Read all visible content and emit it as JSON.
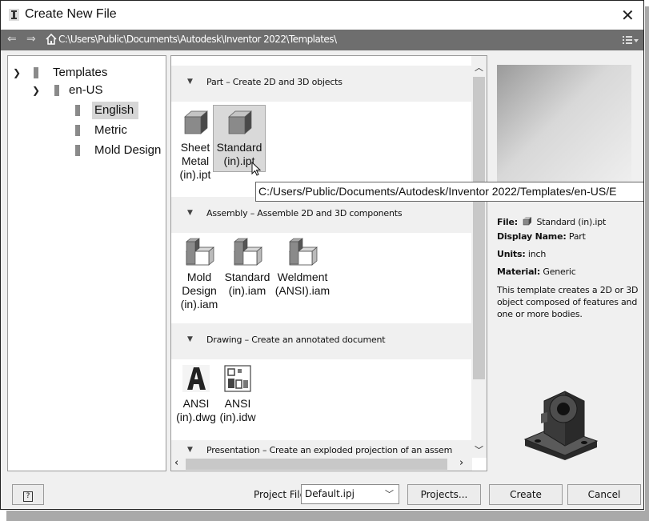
{
  "window": {
    "title": "Create New File",
    "close_glyph": "✕"
  },
  "path_bar": {
    "path": "C:\\Users\\Public\\Documents\\Autodesk\\Inventor 2022\\Templates\\",
    "back_glyph": "⇐",
    "forward_glyph": "⇒"
  },
  "tree": [
    {
      "label": "Templates",
      "level": 0,
      "expanded": true
    },
    {
      "label": "en-US",
      "level": 1,
      "expanded": true
    },
    {
      "label": "English",
      "level": 2,
      "selected": true
    },
    {
      "label": "Metric",
      "level": 2
    },
    {
      "label": "Mold Design",
      "level": 2
    }
  ],
  "categories": {
    "part": {
      "label": "Part – Create 2D and 3D objects",
      "items": [
        {
          "lines": [
            "Sheet",
            "Metal",
            "(in).ipt"
          ],
          "icon": "part-block-icon"
        },
        {
          "lines": [
            "Standard",
            "(in).ipt"
          ],
          "icon": "part-block-icon",
          "selected": true
        }
      ]
    },
    "assembly": {
      "label": "Assembly – Assemble 2D and 3D components",
      "items": [
        {
          "lines": [
            "Mold",
            "Design",
            "(in).iam"
          ],
          "icon": "assembly-icon"
        },
        {
          "lines": [
            "Standard",
            "(in).iam"
          ],
          "icon": "assembly-icon"
        },
        {
          "lines": [
            "Weldment",
            "(ANSI).iam"
          ],
          "icon": "assembly-icon"
        }
      ]
    },
    "drawing": {
      "label": "Drawing – Create an annotated document",
      "items": [
        {
          "lines": [
            "ANSI",
            "(in).dwg"
          ],
          "icon": "dwg-icon"
        },
        {
          "lines": [
            "ANSI",
            "(in).idw"
          ],
          "icon": "idw-icon"
        }
      ]
    },
    "presentation": {
      "label": "Presentation – Create an exploded projection of an assem"
    }
  },
  "tooltip": "C:/Users/Public/Documents/Autodesk/Inventor 2022/Templates/en-US/E",
  "info": {
    "file_label": "File:",
    "file_value": "Standard (in).ipt",
    "display_name_label": "Display Name:",
    "display_name_value": "Part",
    "units_label": "Units:",
    "units_value": "inch",
    "material_label": "Material:",
    "material_value": "Generic",
    "description": "This template creates a 2D or 3D object composed of features and one or more bodies."
  },
  "footer": {
    "help_glyph": "?",
    "project_file_label": "Project File:",
    "project_file_value": "Default.ipj",
    "projects_button": "Projects...",
    "create_button": "Create",
    "cancel_button": "Cancel"
  },
  "colors": {
    "path_bar_bg": "#6e6e6e",
    "selection_bg": "#d6d6d6",
    "part_gray": "#8a8a8a"
  }
}
